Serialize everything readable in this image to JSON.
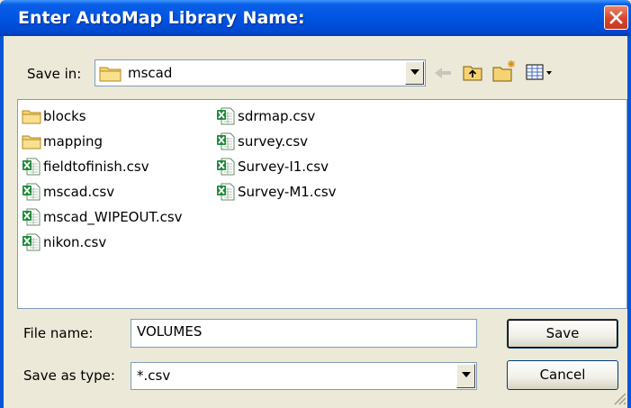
{
  "dialog": {
    "title": "Enter AutoMap Library Name:"
  },
  "save_in": {
    "label": "Save in:",
    "value": "mscad"
  },
  "toolbar": {
    "back_icon": "back-arrow-icon",
    "up_icon": "up-folder-icon",
    "new_folder_icon": "new-folder-icon",
    "views_icon": "view-menu-icon"
  },
  "files": {
    "col1": [
      {
        "name": "blocks",
        "icon": "folder"
      },
      {
        "name": "mapping",
        "icon": "folder"
      },
      {
        "name": "fieldtofinish.csv",
        "icon": "excel"
      },
      {
        "name": "mscad.csv",
        "icon": "excel"
      },
      {
        "name": "mscad_WIPEOUT.csv",
        "icon": "excel"
      },
      {
        "name": "nikon.csv",
        "icon": "excel"
      }
    ],
    "col2": [
      {
        "name": "sdrmap.csv",
        "icon": "excel"
      },
      {
        "name": "survey.csv",
        "icon": "excel"
      },
      {
        "name": "Survey-I1.csv",
        "icon": "excel"
      },
      {
        "name": "Survey-M1.csv",
        "icon": "excel"
      }
    ]
  },
  "file_name": {
    "label": "File name:",
    "value": "VOLUMES"
  },
  "save_as_type": {
    "label": "Save as type:",
    "value": "*.csv"
  },
  "buttons": {
    "save": "Save",
    "cancel": "Cancel"
  }
}
